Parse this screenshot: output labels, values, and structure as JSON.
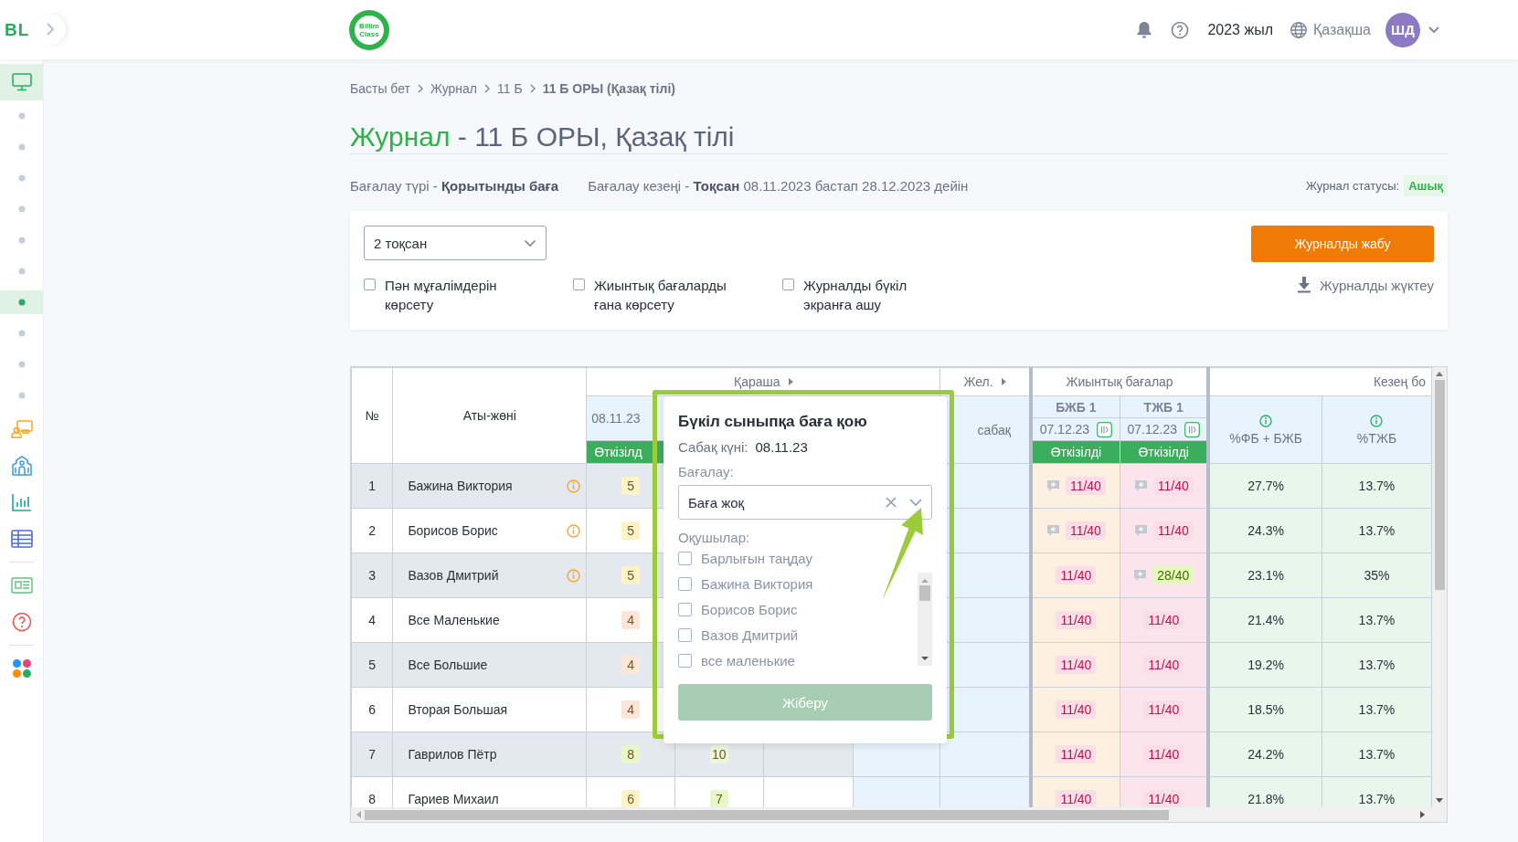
{
  "topbar": {
    "logo": "BL",
    "brand_logo": "Billim Class",
    "year": "2023 жыл",
    "language": "Қазақша",
    "avatar": "ШД"
  },
  "sidebar": {
    "items": [
      {
        "kind": "monitor",
        "selected": true
      },
      {
        "kind": "dot",
        "selected": false
      },
      {
        "kind": "dot",
        "selected": false
      },
      {
        "kind": "dot",
        "selected": false
      },
      {
        "kind": "dot",
        "selected": false
      },
      {
        "kind": "dot",
        "selected": false
      },
      {
        "kind": "dot",
        "selected": false
      },
      {
        "kind": "dot",
        "selected": true
      },
      {
        "kind": "dot",
        "selected": false
      },
      {
        "kind": "dot",
        "selected": false
      },
      {
        "kind": "dot",
        "selected": false
      },
      {
        "kind": "teacher",
        "selected": false
      },
      {
        "kind": "school",
        "selected": false
      },
      {
        "kind": "chart",
        "selected": false
      },
      {
        "kind": "table",
        "selected": false
      },
      {
        "kind": "divider"
      },
      {
        "kind": "news",
        "selected": false
      },
      {
        "kind": "help",
        "selected": false
      },
      {
        "kind": "divider"
      },
      {
        "kind": "apps",
        "selected": false
      }
    ]
  },
  "breadcrumbs": [
    {
      "label": "Басты бет",
      "current": false
    },
    {
      "label": "Журнал",
      "current": false
    },
    {
      "label": "11 Б",
      "current": false
    },
    {
      "label": "11 Б ОРЫ (Қазақ тілі)",
      "current": true
    }
  ],
  "title_prefix": "Журнал",
  "title": "- 11 Б ОРЫ, Қазақ тілі",
  "info": {
    "assessment_type": "Бағалау түрі - **Қорытынды баға**",
    "period": "Бағалау кезеңі - **Тоқсан** 08.11.2023 бастап 28.12.2023 дейін",
    "status_label": "Журнал статусы:",
    "status": "Ашық"
  },
  "filters": {
    "period_select": "2 тоқсан",
    "checkboxes": [
      {
        "label": "Пән мұғалімдерін көрсету",
        "checked": false
      },
      {
        "label": "Жиынтық бағаларды ғана көрсету",
        "checked": false
      },
      {
        "label": "Журналды бүкіл экранға ашу",
        "checked": false
      }
    ],
    "close_button": "Журналды жабу",
    "download_link": "Журналды жүктеу"
  },
  "table": {
    "number_header": "№",
    "name_header": "Аты-жөні",
    "month_header": "Қараша",
    "month2_header": "Жел.",
    "summative_header": "Жиынтық бағалар",
    "period_header": "Кезең бо",
    "lesson": {
      "date": "08.11.23",
      "status": "Өткізілд"
    },
    "lesson2_label": "сабақ",
    "summative": [
      {
        "title": "БЖБ 1",
        "date": "07.12.23",
        "status": "Өткізілді"
      },
      {
        "title": "ТЖБ 1",
        "date": "07.12.23",
        "status": "Өткізілді"
      }
    ],
    "percent_headers": [
      "%ФБ + БЖБ",
      "%ТЖБ"
    ],
    "rows": [
      {
        "number": "1",
        "name": "Бажина Виктория",
        "warning": true,
        "grade": {
          "value": "5",
          "color": "#fdf3c6"
        },
        "summative": [
          {
            "score": "11/40",
            "kind": "low",
            "comment": true
          },
          {
            "score": "11/40",
            "kind": "low",
            "comment": true
          }
        ],
        "percents": [
          "27.7%",
          "13.7%"
        ]
      },
      {
        "number": "2",
        "name": "Борисов Борис",
        "warning": true,
        "grade": {
          "value": "5",
          "color": "#fdf3c6"
        },
        "summative": [
          {
            "score": "11/40",
            "kind": "low",
            "comment": true
          },
          {
            "score": "11/40",
            "kind": "low",
            "comment": true
          }
        ],
        "percents": [
          "24.3%",
          "13.7%"
        ]
      },
      {
        "number": "3",
        "name": "Вазов Дмитрий",
        "warning": true,
        "grade": {
          "value": "5",
          "color": "#fdf3c6"
        },
        "summative": [
          {
            "score": "11/40",
            "kind": "low",
            "comment": false
          },
          {
            "score": "28/40",
            "kind": "high",
            "comment": true
          }
        ],
        "percents": [
          "23.1%",
          "35%"
        ]
      },
      {
        "number": "4",
        "name": "Все Маленькие",
        "warning": false,
        "grade": {
          "value": "4",
          "color": "#fde6d8"
        },
        "summative": [
          {
            "score": "11/40",
            "kind": "low",
            "comment": false
          },
          {
            "score": "11/40",
            "kind": "low",
            "comment": false
          }
        ],
        "percents": [
          "21.4%",
          "13.7%"
        ]
      },
      {
        "number": "5",
        "name": "Все Большие",
        "warning": false,
        "grade": {
          "value": "4",
          "color": "#fde6d8"
        },
        "summative": [
          {
            "score": "11/40",
            "kind": "low",
            "comment": false
          },
          {
            "score": "11/40",
            "kind": "low",
            "comment": false
          }
        ],
        "percents": [
          "19.2%",
          "13.7%"
        ]
      },
      {
        "number": "6",
        "name": "Вторая Большая",
        "warning": false,
        "grade": {
          "value": "4",
          "color": "#fde6d8"
        },
        "summative": [
          {
            "score": "11/40",
            "kind": "low",
            "comment": false
          },
          {
            "score": "11/40",
            "kind": "low",
            "comment": false
          }
        ],
        "percents": [
          "18.5%",
          "13.7%"
        ]
      },
      {
        "number": "7",
        "name": "Гаврилов Пётр",
        "warning": false,
        "grade": {
          "value": "8",
          "color": "#e8f7c8"
        },
        "grade2": {
          "value": "10",
          "color": "#eef6dc"
        },
        "summative": [
          {
            "score": "11/40",
            "kind": "low",
            "comment": false
          },
          {
            "score": "11/40",
            "kind": "low",
            "comment": false
          }
        ],
        "percents": [
          "24.2%",
          "13.7%"
        ]
      },
      {
        "number": "8",
        "name": "Гариев Михаил",
        "warning": false,
        "grade": {
          "value": "6",
          "color": "#fdf3c6"
        },
        "grade2": {
          "value": "7",
          "color": "#e8f7c8"
        },
        "summative": [
          {
            "score": "11/40",
            "kind": "low",
            "comment": false
          },
          {
            "score": "11/40",
            "kind": "low",
            "comment": false
          }
        ],
        "percents": [
          "21.8%",
          "13.7%"
        ]
      }
    ]
  },
  "popup": {
    "title": "Бүкіл сыныпқа баға қою",
    "date_label": "Сабақ күні:",
    "date": "08.11.23",
    "grade_label": "Бағалау:",
    "grade_value": "Баға жоқ",
    "students_label": "Оқушылар:",
    "select_all": {
      "label": "Барлығын таңдау",
      "checked": false
    },
    "students": [
      {
        "label": "Бажина Виктория",
        "checked": false
      },
      {
        "label": "Борисов Борис",
        "checked": false
      },
      {
        "label": "Вазов Дмитрий",
        "checked": false
      },
      {
        "label": "все маленькие",
        "checked": false
      }
    ],
    "submit": {
      "label": "Жіберу",
      "disabled": true
    }
  }
}
